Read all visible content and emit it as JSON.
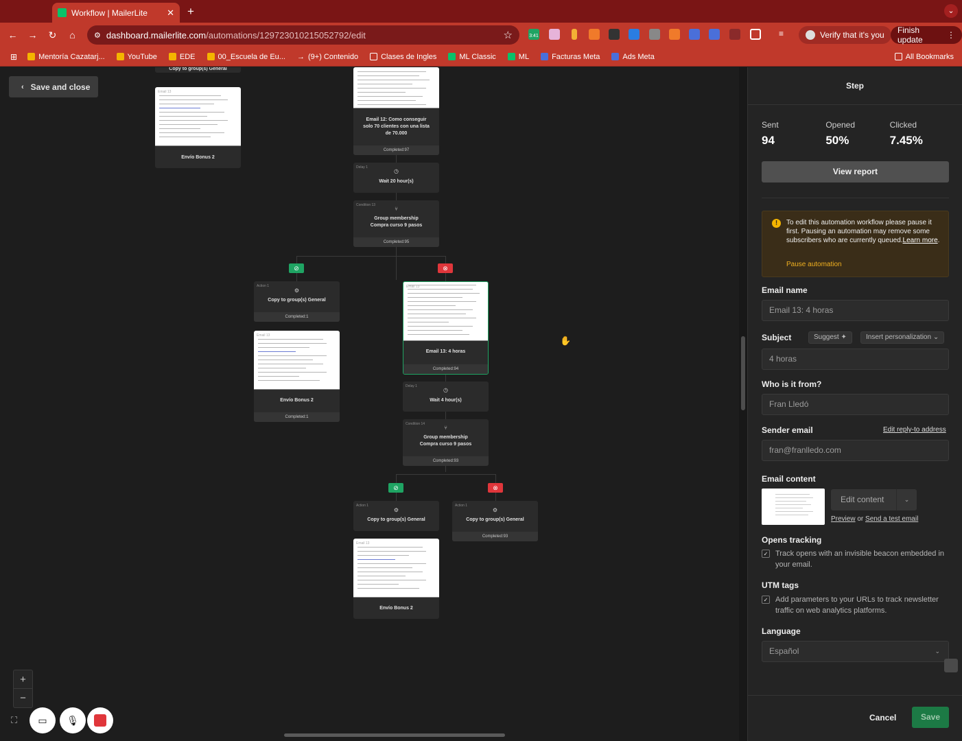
{
  "browser": {
    "tab_title": "Workflow | MailerLite",
    "url_host": "dashboard.mailerlite.com",
    "url_path": "/automations/129723010215052792/edit",
    "verify_label": "Verify that it's you",
    "update_label": "Finish update",
    "bookmarks": [
      "Mentoría Cazatarj...",
      "YouTube",
      "EDE",
      "00_Escuela de Eu...",
      "(9+) Contenido",
      "Clases de Ingles",
      "ML Classic",
      "ML",
      "Facturas Meta",
      "Ads Meta"
    ],
    "all_bookmarks": "All Bookmarks",
    "ext_badge": "3:41"
  },
  "canvas": {
    "save_close": "Save and close",
    "nodes": {
      "top_action": "Copy to group(s) General",
      "email_left_top": {
        "label": "Email 13",
        "name": "Envío Bonus 2"
      },
      "email12": {
        "name": "Email 12: Como conseguir solo 70 clientes con una lista de 70.000",
        "completed": "Completed:97"
      },
      "delay1": {
        "label": "Delay 1",
        "text": "Wait 20 hour(s)"
      },
      "cond13": {
        "label": "Condition 13",
        "text": "Group membership Compra curso 9 pasos",
        "completed": "Completed:95"
      },
      "action_left": {
        "label": "Action 1",
        "text": "Copy to group(s) General",
        "completed": "Completed:1"
      },
      "email_left_mid": {
        "label": "Email 13",
        "name": "Envío Bonus 2",
        "completed": "Completed:1"
      },
      "email13": {
        "label": "Email 13",
        "name": "Email 13: 4 horas",
        "completed": "Completed:94"
      },
      "delay2": {
        "label": "Delay 1",
        "text": "Wait 4 hour(s)"
      },
      "cond14": {
        "label": "Condition 14",
        "text": "Group membership Compra curso 9 pasos",
        "completed": "Completed:93"
      },
      "action_bl": {
        "label": "Action 1",
        "text": "Copy to group(s) General"
      },
      "action_br": {
        "label": "Action 1",
        "text": "Copy to group(s) General",
        "completed": "Completed:93"
      },
      "email_bottom": {
        "label": "Email 13",
        "name": "Envío Bonus 2"
      }
    }
  },
  "panel": {
    "title": "Step",
    "stats": [
      {
        "label": "Sent",
        "value": "94"
      },
      {
        "label": "Opened",
        "value": "50%"
      },
      {
        "label": "Clicked",
        "value": "7.45%"
      }
    ],
    "view_report": "View report",
    "warning": {
      "text": "To edit this automation workflow please pause it first. Pausing an automation may remove some subscribers who are currently queued.",
      "learn_more": "Learn more",
      "action": "Pause automation"
    },
    "email_name_label": "Email name",
    "email_name": "Email 13: 4 horas",
    "subject_label": "Subject",
    "suggest": "Suggest",
    "insert_personalization": "Insert personalization",
    "subject": "4 horas",
    "from_label": "Who is it from?",
    "from": "Fran Lledó",
    "sender_label": "Sender email",
    "edit_reply": "Edit reply-to address",
    "sender": "fran@franlledo.com",
    "content_label": "Email content",
    "edit_content": "Edit content",
    "preview": "Preview",
    "or": "or",
    "send_test": "Send a test email",
    "opens_label": "Opens tracking",
    "opens_text": "Track opens with an invisible beacon embedded in your email.",
    "utm_label": "UTM tags",
    "utm_text": "Add parameters to your URLs to track newsletter traffic on web analytics platforms.",
    "language_label": "Language",
    "language": "Español",
    "cancel": "Cancel",
    "save": "Save"
  },
  "colors": {
    "accent": "#1fa463",
    "danger": "#e0363b",
    "warning": "#f0b020",
    "browser": "#c0392b"
  }
}
